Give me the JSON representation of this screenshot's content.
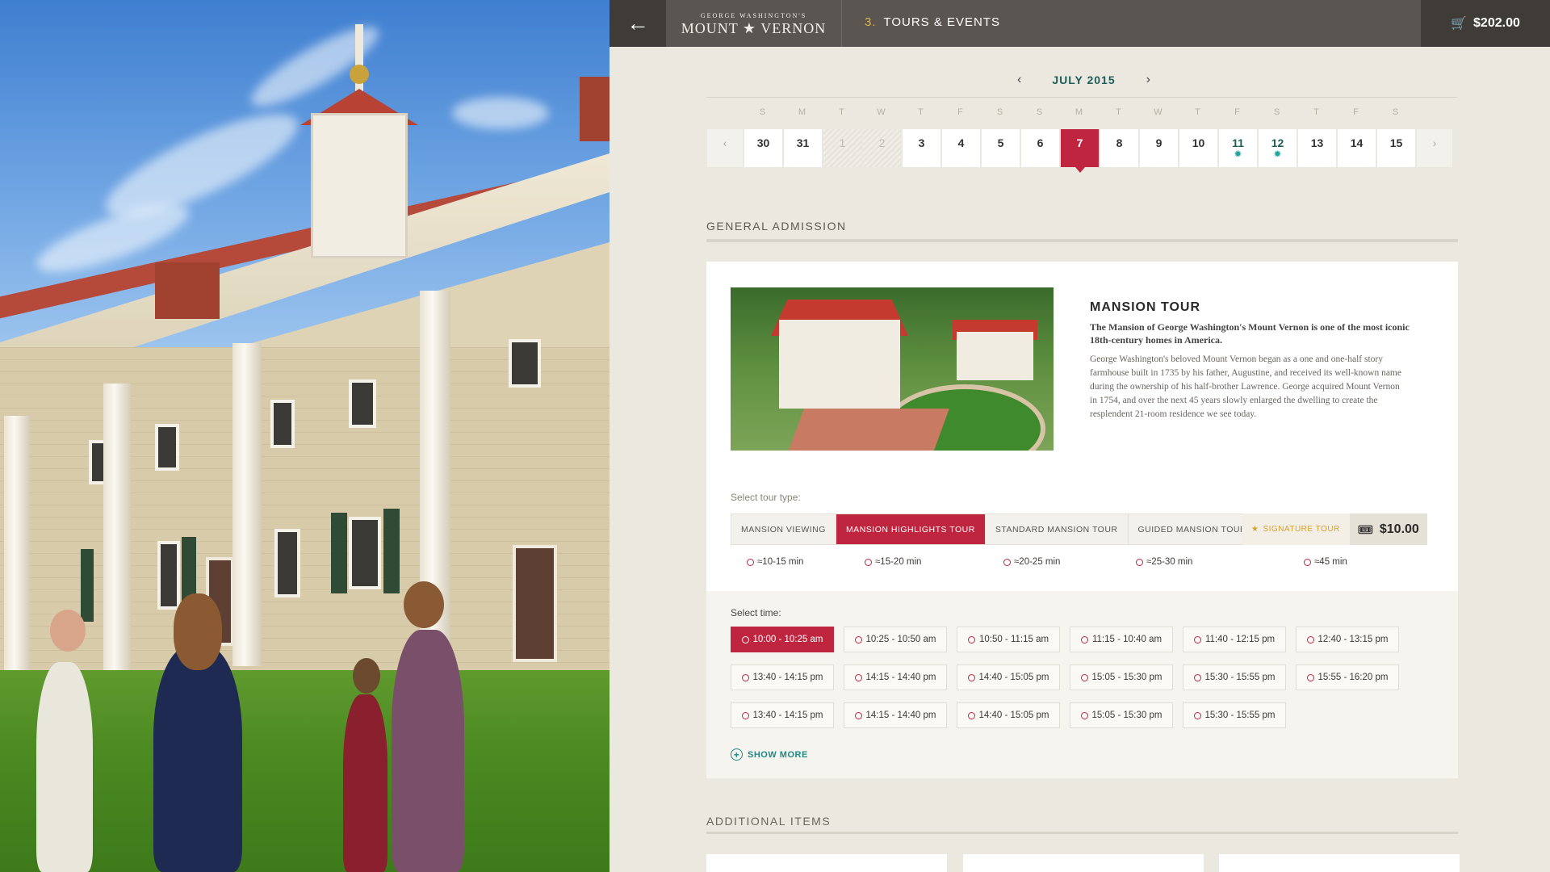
{
  "header": {
    "back_icon": "arrow-left-icon",
    "logo_small": "GEORGE WASHINGTON'S",
    "logo_big": "MOUNT ★ VERNON",
    "step_number": "3.",
    "step_title": "TOURS & EVENTS",
    "cart_icon": "cart-icon",
    "cart_total": "$202.00"
  },
  "calendar": {
    "month": "JULY 2015",
    "prev_icon": "‹",
    "next_icon": "›",
    "weekdays": [
      "S",
      "M",
      "T",
      "W",
      "T",
      "F",
      "S",
      "S",
      "M",
      "T",
      "W",
      "T",
      "F",
      "S",
      "T",
      "F",
      "S"
    ],
    "days": [
      {
        "label": "30",
        "state": "normal"
      },
      {
        "label": "31",
        "state": "normal"
      },
      {
        "label": "1",
        "state": "disabled"
      },
      {
        "label": "2",
        "state": "disabled"
      },
      {
        "label": "3",
        "state": "normal"
      },
      {
        "label": "4",
        "state": "normal"
      },
      {
        "label": "5",
        "state": "normal"
      },
      {
        "label": "6",
        "state": "normal"
      },
      {
        "label": "7",
        "state": "selected"
      },
      {
        "label": "8",
        "state": "normal"
      },
      {
        "label": "9",
        "state": "normal"
      },
      {
        "label": "10",
        "state": "normal"
      },
      {
        "label": "11",
        "state": "event"
      },
      {
        "label": "12",
        "state": "event"
      },
      {
        "label": "13",
        "state": "normal"
      },
      {
        "label": "14",
        "state": "normal"
      },
      {
        "label": "15",
        "state": "normal"
      }
    ]
  },
  "general_admission": {
    "section_title": "GENERAL ADMISSION",
    "title": "MANSION TOUR",
    "lead": "The Mansion of George Washington's Mount Vernon is one of the most iconic 18th-century homes in America.",
    "body": "George Washington's beloved Mount Vernon began as a one and one-half story farmhouse built in 1735 by his father, Augustine, and received its well-known name during the ownership of his half-brother Lawrence. George acquired Mount Vernon in 1754, and over the next 45 years slowly enlarged the dwelling to create the resplendent 21-room residence we see today.",
    "tour_type_label": "Select tour type:",
    "tour_types": [
      {
        "label": "MANSION VIEWING",
        "duration": "≈10-15 min",
        "active": false
      },
      {
        "label": "MANSION HIGHLIGHTS TOUR",
        "duration": "≈15-20 min",
        "active": true
      },
      {
        "label": "STANDARD MANSION TOUR",
        "duration": "≈20-25 min",
        "active": false
      },
      {
        "label": "GUIDED MANSION TOUR",
        "duration": "≈25-30 min",
        "active": false
      }
    ],
    "signature": {
      "label": "SIGNATURE TOUR",
      "star": "★",
      "ticket_icon": "ticket-icon",
      "price": "$10.00",
      "duration": "≈45 min"
    },
    "time_label": "Select time:",
    "time_slots": [
      [
        "10:00 - 10:25 am",
        "10:25 - 10:50 am",
        "10:50 - 11:15 am",
        "11:15 - 10:40 am",
        "11:40 - 12:15 pm",
        "12:40 - 13:15 pm"
      ],
      [
        "13:40 - 14:15 pm",
        "14:15 - 14:40 pm",
        "14:40 - 15:05 pm",
        "15:05 - 15:30 pm",
        "15:30 - 15:55 pm",
        "15:55 - 16:20 pm"
      ],
      [
        "13:40 - 14:15 pm",
        "14:15 - 14:40 pm",
        "14:40 - 15:05 pm",
        "15:05 - 15:30 pm",
        "15:30 - 15:55 pm"
      ]
    ],
    "selected_slot": "10:00 - 10:25 am",
    "show_more": "SHOW MORE"
  },
  "additional": {
    "section_title": "ADDITIONAL ITEMS"
  },
  "colors": {
    "accent": "#c0253f",
    "teal": "#1d8a86",
    "gold": "#e0b54b",
    "topbar": "#5a5550"
  }
}
